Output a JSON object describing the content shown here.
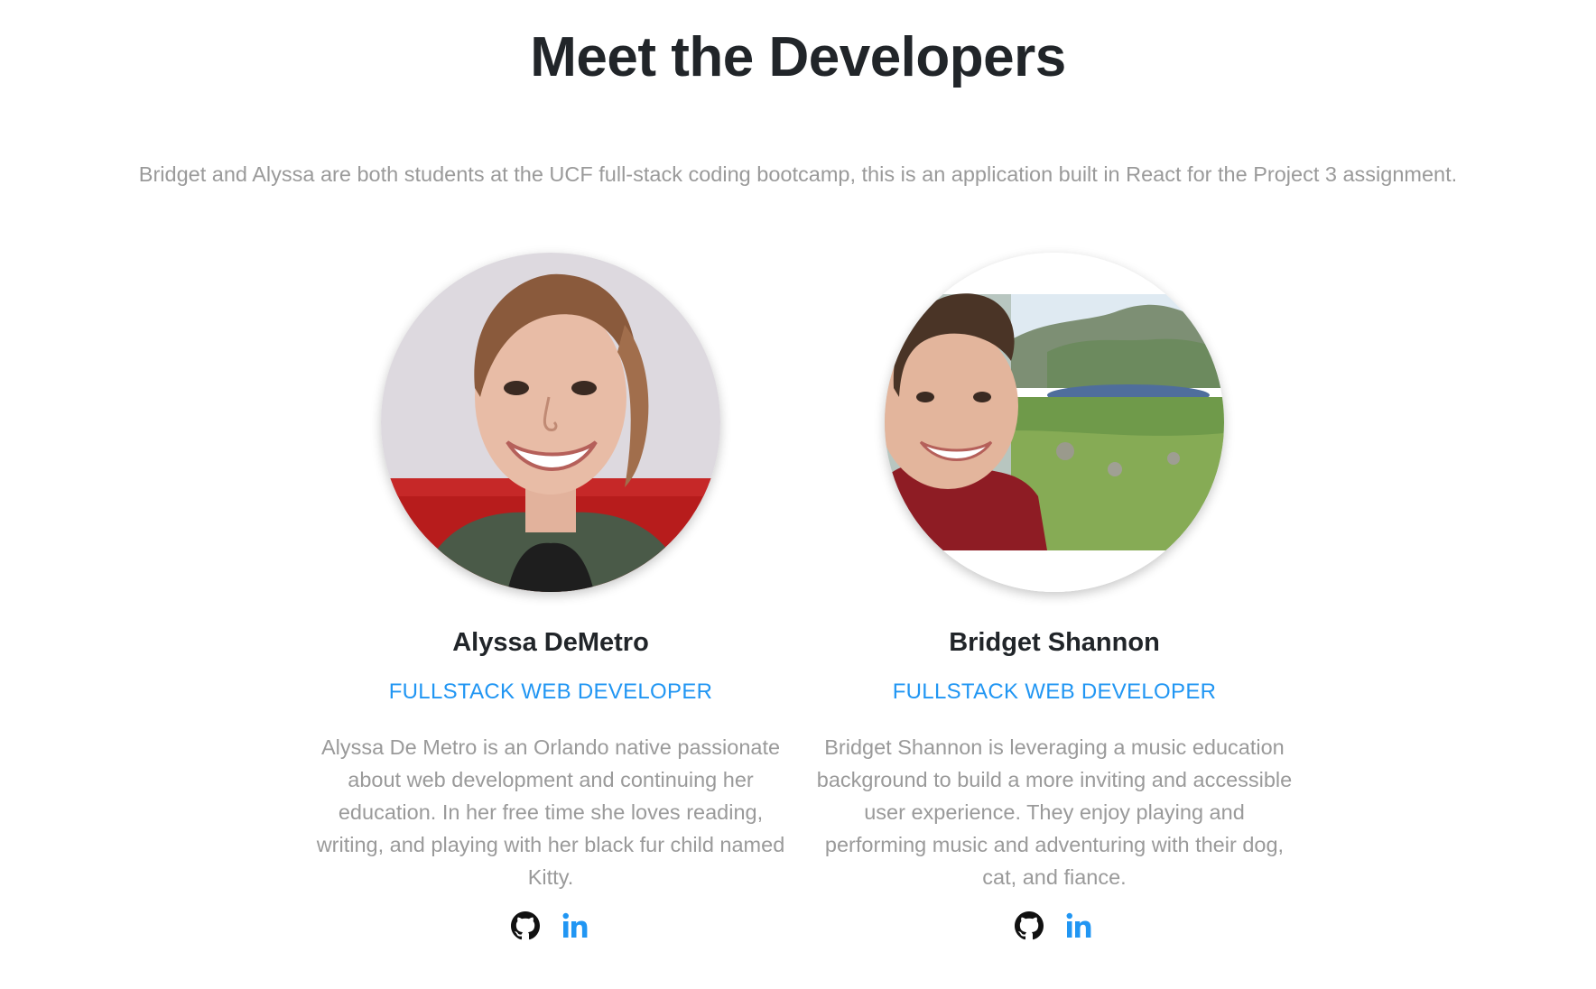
{
  "header": {
    "title": "Meet the Developers",
    "intro": "Bridget and Alyssa are both students at the UCF full-stack coding bootcamp, this is an application built in React for the Project 3 assignment."
  },
  "developers": [
    {
      "name": "Alyssa DeMetro",
      "role": "FULLSTACK WEB DEVELOPER",
      "bio": "Alyssa De Metro is an Orlando native passionate about web development and continuing her education. In her free time she loves reading, writing, and playing with her black fur child named Kitty.",
      "photo_alt": "Alyssa DeMetro",
      "links": [
        {
          "icon": "github-icon"
        },
        {
          "icon": "linkedin-icon"
        }
      ]
    },
    {
      "name": "Bridget Shannon",
      "role": "FULLSTACK WEB DEVELOPER",
      "bio": "Bridget Shannon is leveraging a music education background to build a more inviting and accessible user experience. They enjoy playing and performing music and adventuring with their dog, cat, and fiance.",
      "photo_alt": "Bridget Shannon",
      "links": [
        {
          "icon": "github-icon"
        },
        {
          "icon": "linkedin-icon"
        }
      ]
    }
  ],
  "colors": {
    "heading": "#212529",
    "muted_text": "#9a9a9a",
    "accent": "#2196f3"
  }
}
